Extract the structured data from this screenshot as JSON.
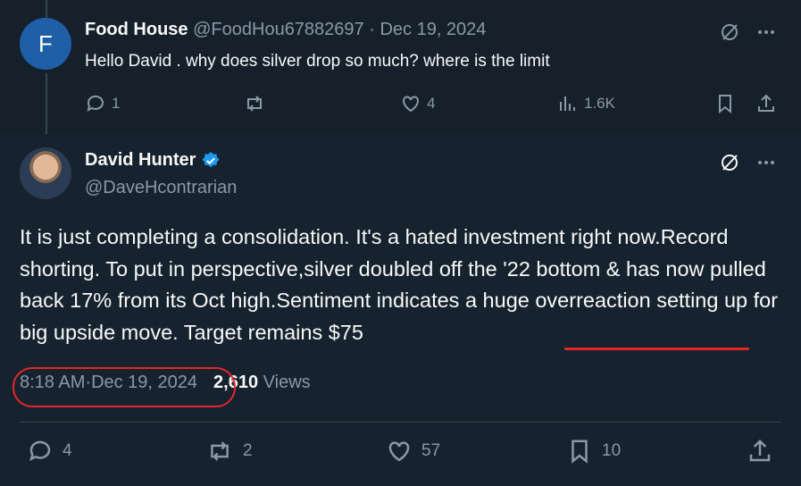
{
  "reply": {
    "avatar_letter": "F",
    "name": "Food House",
    "handle": "@FoodHou67882697",
    "separator": " · ",
    "date": "Dec 19, 2024",
    "text": "Hello David . why does silver drop so much? where is the limit",
    "actions": {
      "replies": "1",
      "retweets": "",
      "likes": "4",
      "views": "1.6K"
    }
  },
  "tweet": {
    "name": "David Hunter",
    "handle": "@DaveHcontrarian",
    "verified": true,
    "text_part1": "It is just completing a consolidation. It's a hated investment right now.Record shorting. To put in perspective,silver doubled off the '22 bottom & has now pulled back 17% from its Oct high.Sentiment indicates a huge overreaction setting up for big upside move. ",
    "text_part2": "Target remains $75",
    "time": "8:18 AM",
    "separator": " · ",
    "date": "Dec 19, 2024",
    "views_count": "2,610",
    "views_label": "Views",
    "actions": {
      "replies": "4",
      "retweets": "2",
      "likes": "57",
      "bookmarks": "10"
    }
  },
  "colors": {
    "background": "#15202b",
    "text": "#f7f9f9",
    "muted": "#8b98a5",
    "verified": "#1d9bf0",
    "annotation": "#e3262b"
  }
}
